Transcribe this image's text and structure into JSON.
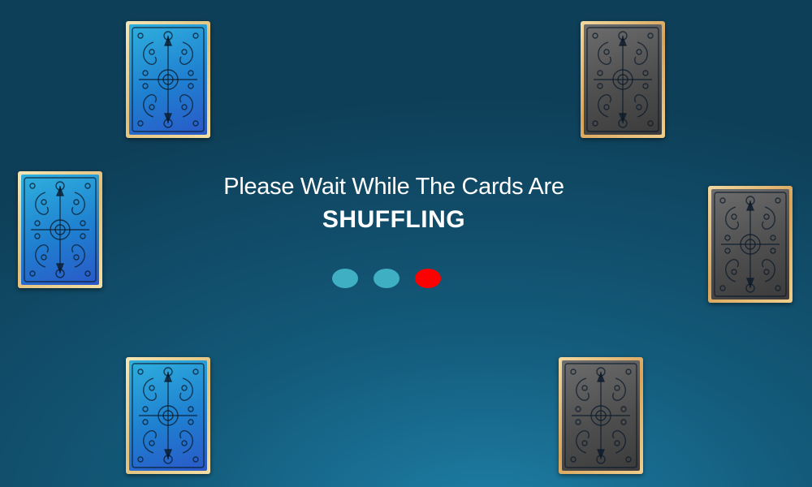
{
  "message": {
    "line1": "Please Wait While The Cards Are",
    "line2": "SHUFFLING"
  },
  "loader": {
    "dots": [
      {
        "color": "#3fb0c4",
        "state": "inactive"
      },
      {
        "color": "#3fb0c4",
        "state": "inactive"
      },
      {
        "color": "#ff0000",
        "state": "active"
      }
    ]
  },
  "cards": [
    {
      "id": "c1",
      "style": "blue-back"
    },
    {
      "id": "c2",
      "style": "blue-back"
    },
    {
      "id": "c3",
      "style": "blue-back"
    },
    {
      "id": "c4",
      "style": "gray-back"
    },
    {
      "id": "c5",
      "style": "gray-back"
    },
    {
      "id": "c6",
      "style": "gray-back"
    }
  ]
}
